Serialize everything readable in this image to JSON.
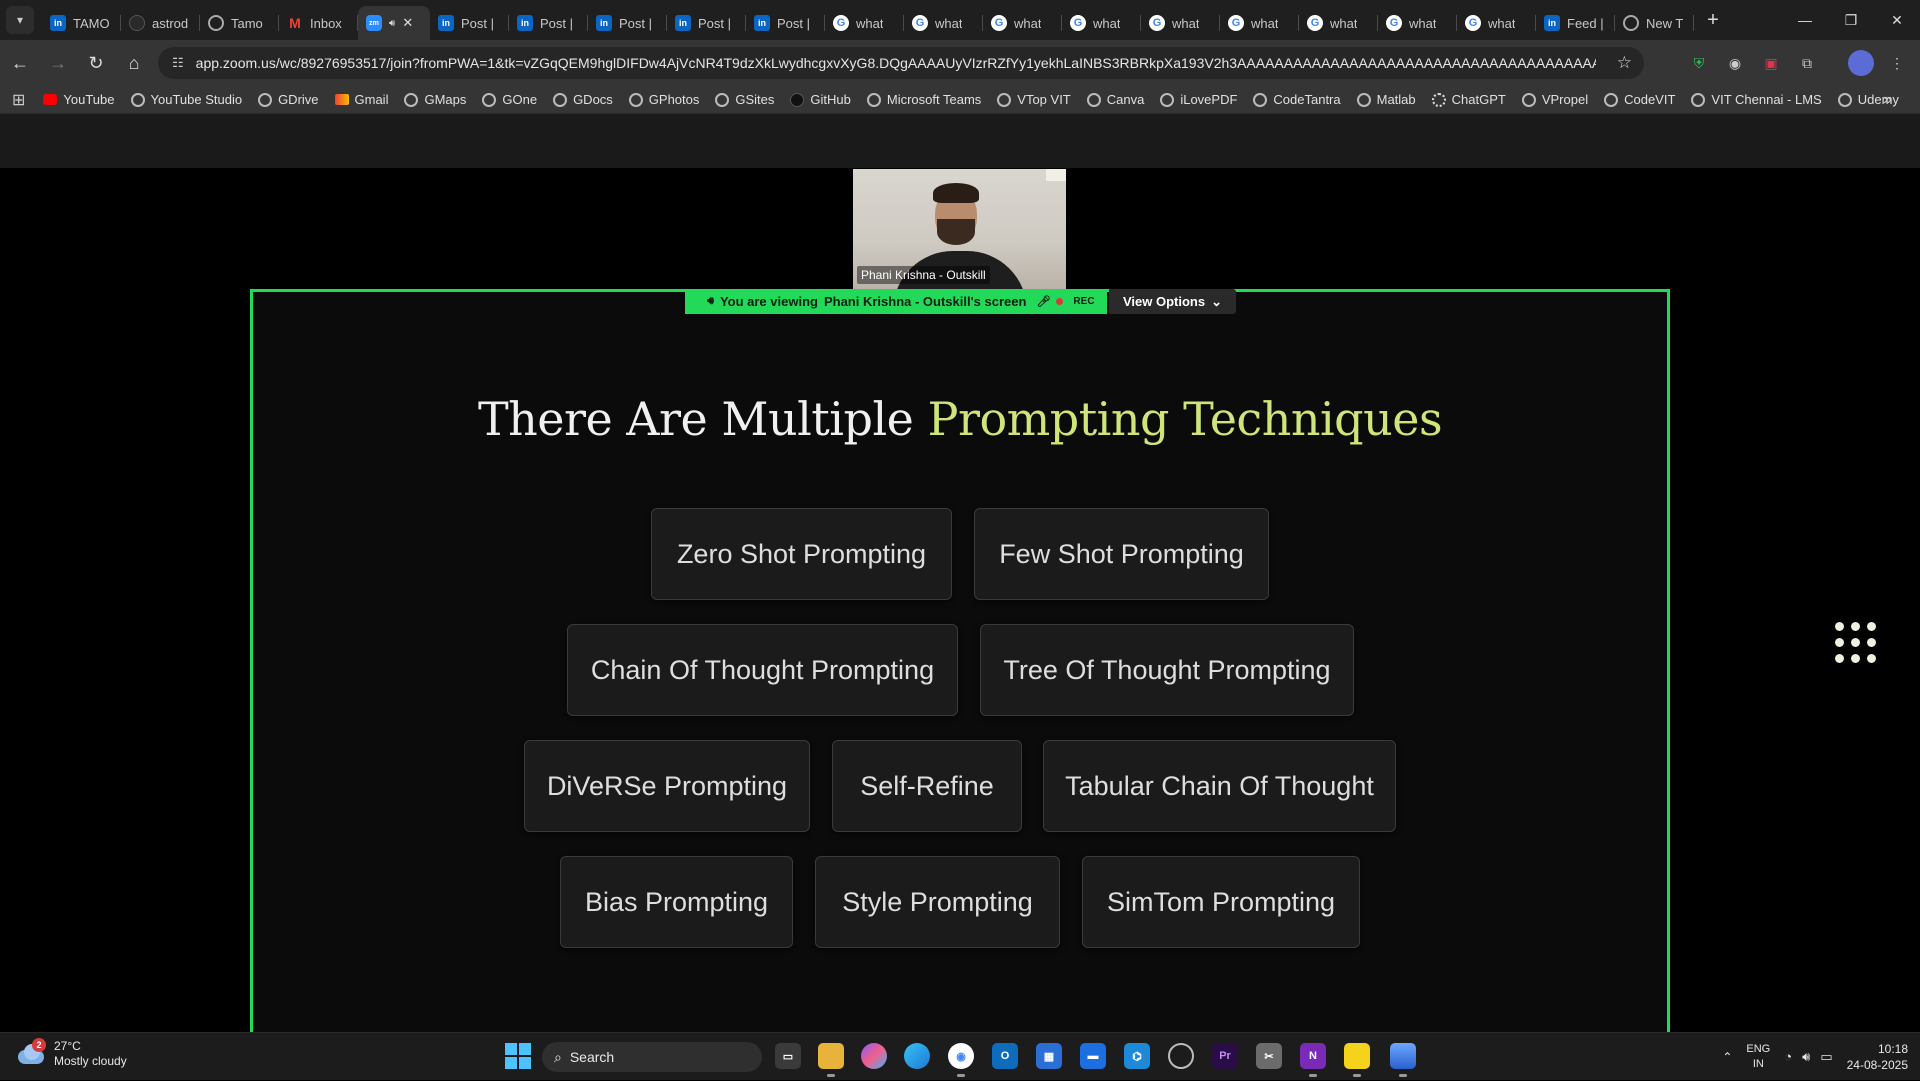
{
  "browser": {
    "tabs": [
      {
        "label": "TAMO",
        "icon": "linkedin-icon",
        "active": false
      },
      {
        "label": "astrod",
        "icon": "astro-icon",
        "active": false
      },
      {
        "label": "Tamo",
        "icon": "globe-icon",
        "active": false
      },
      {
        "label": "Inbox",
        "icon": "gmail-icon",
        "active": false
      },
      {
        "label": "zm",
        "icon": "zoom-icon",
        "active": true
      },
      {
        "label": "Post |",
        "icon": "linkedin-icon",
        "active": false
      },
      {
        "label": "Post |",
        "icon": "linkedin-icon",
        "active": false
      },
      {
        "label": "Post |",
        "icon": "linkedin-icon",
        "active": false
      },
      {
        "label": "Post |",
        "icon": "linkedin-icon",
        "active": false
      },
      {
        "label": "Post |",
        "icon": "linkedin-icon",
        "active": false
      },
      {
        "label": "what",
        "icon": "google-icon",
        "active": false
      },
      {
        "label": "what",
        "icon": "google-icon",
        "active": false
      },
      {
        "label": "what",
        "icon": "google-icon",
        "active": false
      },
      {
        "label": "what",
        "icon": "google-icon",
        "active": false
      },
      {
        "label": "what",
        "icon": "google-icon",
        "active": false
      },
      {
        "label": "what",
        "icon": "google-icon",
        "active": false
      },
      {
        "label": "what",
        "icon": "google-icon",
        "active": false
      },
      {
        "label": "what",
        "icon": "google-icon",
        "active": false
      },
      {
        "label": "what",
        "icon": "google-icon",
        "active": false
      },
      {
        "label": "Feed |",
        "icon": "linkedin-icon",
        "active": false
      },
      {
        "label": "New T",
        "icon": "globe-icon",
        "active": false
      }
    ],
    "url": "app.zoom.us/wc/89276953517/join?fromPWA=1&tk=vZGqQEM9hglDIFDw4AjVcNR4T9dzXkLwydhcgxvXyG8.DQgAAAAUyVIzrRZfYy1yekhLaINBS3RBRkpXa193V2h3AAAAAAAAAAAAAAAAAAAAAAAAAAAAAAAAAAAAAAAA&_x_zm_r...",
    "bookmarks": [
      {
        "label": "YouTube",
        "icon": "youtube-icon"
      },
      {
        "label": "YouTube Studio",
        "icon": "globe-icon"
      },
      {
        "label": "GDrive",
        "icon": "globe-icon"
      },
      {
        "label": "Gmail",
        "icon": "gmail-icon"
      },
      {
        "label": "GMaps",
        "icon": "globe-icon"
      },
      {
        "label": "GOne",
        "icon": "globe-icon"
      },
      {
        "label": "GDocs",
        "icon": "globe-icon"
      },
      {
        "label": "GPhotos",
        "icon": "globe-icon"
      },
      {
        "label": "GSites",
        "icon": "globe-icon"
      },
      {
        "label": "GitHub",
        "icon": "github-icon"
      },
      {
        "label": "Microsoft Teams",
        "icon": "globe-icon"
      },
      {
        "label": "VTop VIT",
        "icon": "globe-icon"
      },
      {
        "label": "Canva",
        "icon": "globe-icon"
      },
      {
        "label": "iLovePDF",
        "icon": "globe-icon"
      },
      {
        "label": "CodeTantra",
        "icon": "globe-icon"
      },
      {
        "label": "Matlab",
        "icon": "globe-icon"
      },
      {
        "label": "ChatGPT",
        "icon": "chatgpt-icon"
      },
      {
        "label": "VPropel",
        "icon": "globe-icon"
      },
      {
        "label": "CodeVIT",
        "icon": "globe-icon"
      },
      {
        "label": "VIT Chennai - LMS",
        "icon": "globe-icon"
      },
      {
        "label": "Udemy",
        "icon": "globe-icon"
      }
    ]
  },
  "zoom": {
    "participant_name": "Phani Krishna - Outskill",
    "banner_prefix": "You are viewing",
    "banner_presenter": "Phani Krishna - Outskill's screen",
    "rec_label": "REC",
    "view_options_label": "View Options",
    "accent_color": "#23d959"
  },
  "slide": {
    "title_plain": "There Are Multiple",
    "title_accent": "Prompting Techniques",
    "accent_color": "#cfe57a",
    "techniques": [
      "Zero Shot Prompting",
      "Few Shot Prompting",
      "Chain Of Thought Prompting",
      "Tree Of Thought Prompting",
      "DiVeRSe Prompting",
      "Self-Refine",
      "Tabular Chain Of Thought",
      "Bias Prompting",
      "Style Prompting",
      "SimTom Prompting"
    ]
  },
  "taskbar": {
    "weather_temp": "27°C",
    "weather_desc": "Mostly cloudy",
    "weather_badge": "2",
    "search_label": "Search",
    "lang_top": "ENG",
    "lang_bottom": "IN",
    "time": "10:18",
    "date": "24-08-2025"
  }
}
